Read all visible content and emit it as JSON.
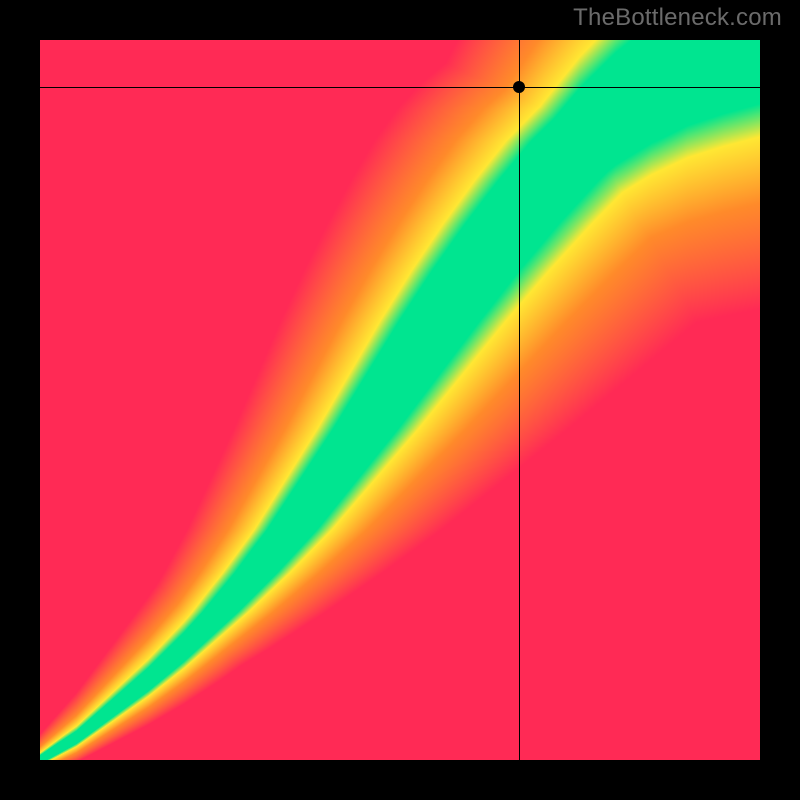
{
  "watermark": "TheBottleneck.com",
  "chart_data": {
    "type": "heatmap",
    "title": "",
    "xlabel": "",
    "ylabel": "",
    "xlim": [
      0,
      100
    ],
    "ylim": [
      0,
      100
    ],
    "grid": false,
    "legend": false,
    "crosshair": {
      "x": 66.5,
      "y": 93.5
    },
    "marker": {
      "x": 66.5,
      "y": 93.5
    },
    "optimal_curve_x": [
      0,
      5,
      10,
      15,
      20,
      25,
      30,
      35,
      40,
      45,
      50,
      55,
      60,
      65,
      70,
      75,
      80,
      85,
      90,
      95,
      100
    ],
    "optimal_curve_y": [
      0,
      3,
      7,
      11,
      15.5,
      20.5,
      26,
      32,
      39,
      46,
      53.5,
      61,
      68,
      74.5,
      80.5,
      86,
      90.5,
      94,
      96.7,
      98.5,
      100
    ],
    "colors": {
      "bad": "#ff2a55",
      "warn": "#ffe733",
      "good": "#00e590",
      "mid_orange": "#ff8a2a"
    },
    "description": "Bottleneck fit heatmap. Green band along optimal_curve indicates balanced pairing; color transitions red→orange→yellow→green→yellow→orange→red with distance from the curve. Black crosshair and dot mark the queried configuration."
  }
}
